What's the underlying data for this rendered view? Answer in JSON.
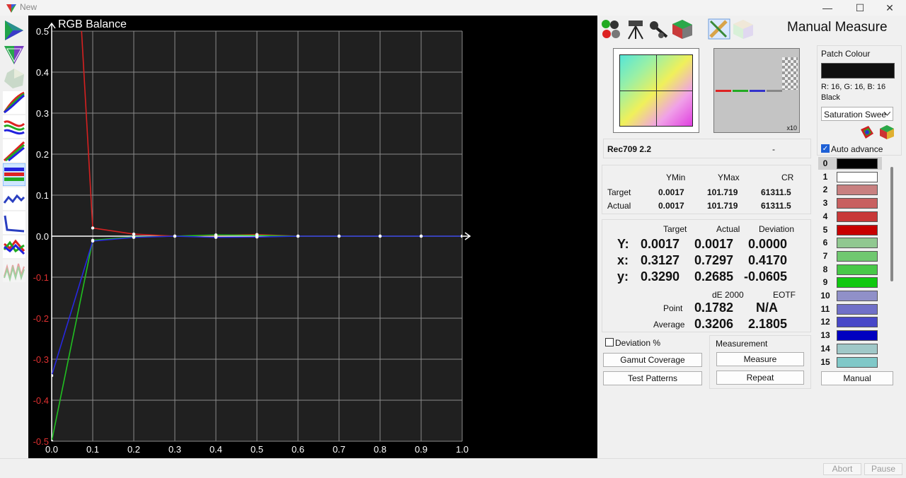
{
  "window": {
    "title": "New",
    "minimize": "—",
    "maximize": "☐",
    "close": "✕"
  },
  "left_toolbar": {
    "tools": [
      "cie-diagram-icon",
      "gamut-triangle-icon",
      "3d-gamut-icon",
      "gamma-curves-icon",
      "rgb-levels-icon",
      "luminance-curves-icon",
      "rgb-balance-icon",
      "delta-e-icon",
      "delta-e-bar-icon",
      "color-temp-icon",
      "waveform-icon"
    ]
  },
  "chart_data": {
    "type": "line",
    "title": "RGB Balance",
    "xlabel": "",
    "ylabel": "",
    "xlim": [
      0,
      1
    ],
    "ylim": [
      -0.5,
      0.5
    ],
    "x_ticks": [
      "0.0",
      "0.1",
      "0.2",
      "0.3",
      "0.4",
      "0.5",
      "0.6",
      "0.7",
      "0.8",
      "0.9",
      "1.0"
    ],
    "y_ticks": [
      "0.5",
      "0.4",
      "0.3",
      "0.2",
      "0.1",
      "0.0",
      "-0.1",
      "-0.2",
      "-0.3",
      "-0.4",
      "-0.5"
    ],
    "grid": true,
    "x": [
      0.0,
      0.1,
      0.2,
      0.3,
      0.4,
      0.5,
      0.6,
      0.7,
      0.8,
      0.9,
      1.0
    ],
    "series": [
      {
        "color": "#d62020",
        "values": [
          2.0,
          0.02,
          0.005,
          0.0,
          0.002,
          0.004,
          0.0,
          0.0,
          0.0,
          0.0,
          0.0
        ]
      },
      {
        "color": "#20c020",
        "values": [
          -0.5,
          -0.01,
          -0.002,
          0.0,
          0.003,
          0.002,
          0.0,
          0.0,
          0.0,
          0.0,
          0.0
        ]
      },
      {
        "color": "#2828e0",
        "values": [
          -0.34,
          -0.012,
          -0.003,
          0.0,
          -0.003,
          -0.002,
          0.0,
          0.0,
          0.0,
          0.0,
          0.0
        ]
      }
    ],
    "red_start_x": 0.07
  },
  "panel": {
    "heading": "Manual Measure",
    "tools": [
      "colour-balls-icon",
      "tripod-meter-icon",
      "probe-icon",
      "3d-cube-icon",
      "pencil-icon",
      "cube-icon"
    ],
    "gray_box_label": "x10",
    "profile_name": "Rec709 2.2",
    "profile_value": "-",
    "luminance": {
      "headers": [
        "YMin",
        "YMax",
        "CR"
      ],
      "target_label": "Target",
      "actual_label": "Actual",
      "target": [
        "0.0017",
        "101.719",
        "61311.5"
      ],
      "actual": [
        "0.0017",
        "101.719",
        "61311.5"
      ]
    },
    "readings": {
      "headers": [
        "Target",
        "Actual",
        "Deviation"
      ],
      "rows": [
        {
          "label": "Y:",
          "target": "0.0017",
          "actual": "0.0017",
          "deviation": "0.0000"
        },
        {
          "label": "x:",
          "target": "0.3127",
          "actual": "0.7297",
          "deviation": "0.4170"
        },
        {
          "label": "y:",
          "target": "0.3290",
          "actual": "0.2685",
          "deviation": "-0.0605"
        }
      ],
      "de_header": "dE 2000",
      "eotf_header": "EOTF",
      "point_label": "Point",
      "point_de": "0.1782",
      "point_eotf": "N/A",
      "average_label": "Average",
      "average_de": "0.3206",
      "average_eotf": "2.1805"
    },
    "deviation_pct_label": "Deviation %",
    "gamut_coverage_btn": "Gamut Coverage",
    "test_patterns_btn": "Test Patterns",
    "measurement_group": "Measurement",
    "measure_btn": "Measure",
    "repeat_btn": "Repeat",
    "patch": {
      "title": "Patch Colour",
      "swatch_color": "#101010",
      "rgb_text": "R: 16, G: 16, B: 16",
      "name": "Black",
      "sequence": "Saturation Swee",
      "auto_advance": "Auto advance",
      "manual_btn": "Manual",
      "items": [
        {
          "num": "0",
          "color": "#000000"
        },
        {
          "num": "1",
          "color": "#ffffff"
        },
        {
          "num": "2",
          "color": "#c88080"
        },
        {
          "num": "3",
          "color": "#c86060"
        },
        {
          "num": "4",
          "color": "#c83838"
        },
        {
          "num": "5",
          "color": "#c80000"
        },
        {
          "num": "6",
          "color": "#90c890"
        },
        {
          "num": "7",
          "color": "#70c870"
        },
        {
          "num": "8",
          "color": "#48c848"
        },
        {
          "num": "9",
          "color": "#10c810"
        },
        {
          "num": "10",
          "color": "#9090c8"
        },
        {
          "num": "11",
          "color": "#7070c8"
        },
        {
          "num": "12",
          "color": "#4848c8"
        },
        {
          "num": "13",
          "color": "#0000c0"
        },
        {
          "num": "14",
          "color": "#a0c8c8"
        },
        {
          "num": "15",
          "color": "#80c8c8"
        }
      ]
    }
  },
  "status": {
    "abort": "Abort",
    "pause": "Pause"
  }
}
